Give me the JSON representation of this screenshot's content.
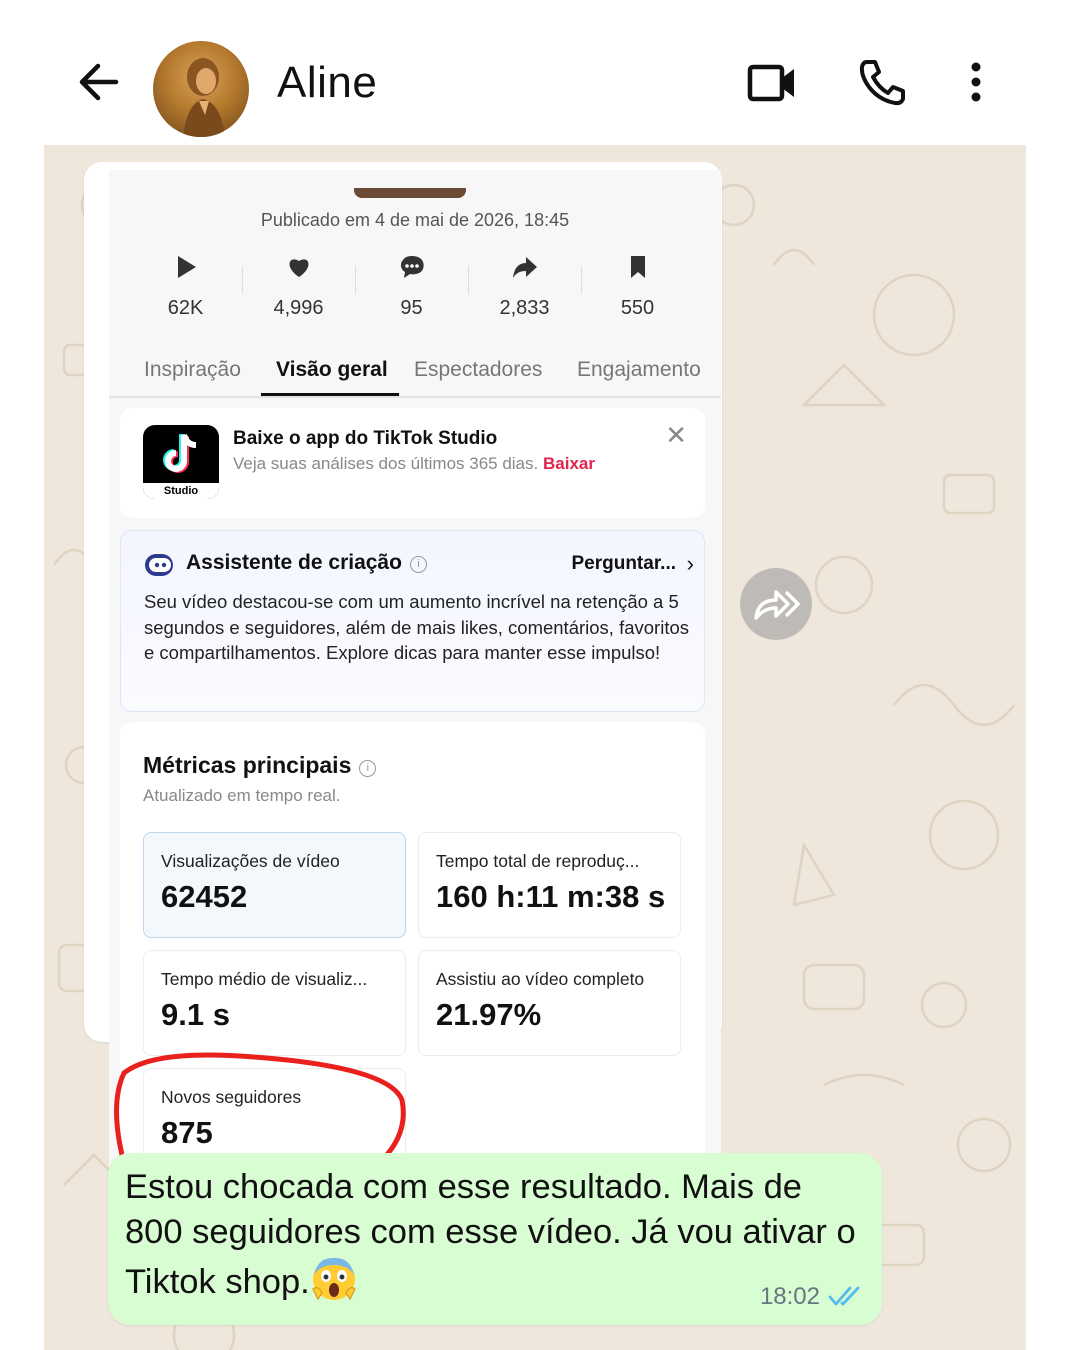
{
  "header": {
    "contact_name": "Aline",
    "icons": [
      "back-arrow-icon",
      "video-call-icon",
      "phone-icon",
      "more-vert-icon"
    ]
  },
  "screenshot": {
    "published": "Publicado em 4 de mai de 2026, 18:45",
    "stats": [
      {
        "icon": "play-icon",
        "value": "62K"
      },
      {
        "icon": "heart-icon",
        "value": "4,996"
      },
      {
        "icon": "comment-icon",
        "value": "95"
      },
      {
        "icon": "share-icon",
        "value": "2,833"
      },
      {
        "icon": "bookmark-icon",
        "value": "550"
      }
    ],
    "tabs": [
      {
        "label": "Inspiração",
        "active": false
      },
      {
        "label": "Visão geral",
        "active": true
      },
      {
        "label": "Espectadores",
        "active": false
      },
      {
        "label": "Engajamento",
        "active": false
      }
    ],
    "banner": {
      "logo_text": "Studio",
      "title": "Baixe o app do TikTok Studio",
      "subtitle": "Veja suas análises dos últimos 365 dias.",
      "link": "Baixar",
      "close": "✕"
    },
    "assistant": {
      "title": "Assistente de criação",
      "info": "i",
      "ask": "Perguntar...",
      "ask_chevron": "›",
      "text": "Seu vídeo destacou-se com um aumento incrível na retenção a 5 segundos e seguidores, além de mais likes, comentários, favoritos e compartilhamentos. Explore dicas para manter esse impulso!"
    },
    "metrics": {
      "title": "Métricas principais",
      "info": "i",
      "subtitle": "Atualizado em tempo real.",
      "items": [
        {
          "label": "Visualizações de vídeo",
          "value": "62452",
          "selected": true
        },
        {
          "label": "Tempo total de reproduç...",
          "value": "160 h:11 m:38 s",
          "selected": false
        },
        {
          "label": "Tempo médio de visualiz...",
          "value": "9.1 s",
          "selected": false
        },
        {
          "label": "Assistiu ao vídeo completo",
          "value": "21.97%",
          "selected": false
        },
        {
          "label": "Novos seguidores",
          "value": "875",
          "selected": false
        }
      ]
    },
    "highlight_color": "#e8211c"
  },
  "message": {
    "text": "Estou chocada com esse resultado. Mais de 800 seguidores com esse vídeo. Já vou ativar o Tiktok shop.",
    "emoji": "face-screaming-in-fear",
    "time": "18:02",
    "status": "read",
    "tick_color": "#53bdeb"
  },
  "colors": {
    "outgoing_bubble": "#d9fdd3",
    "chat_background": "#efe7dc",
    "tiktok_accent": "#e0254e"
  }
}
